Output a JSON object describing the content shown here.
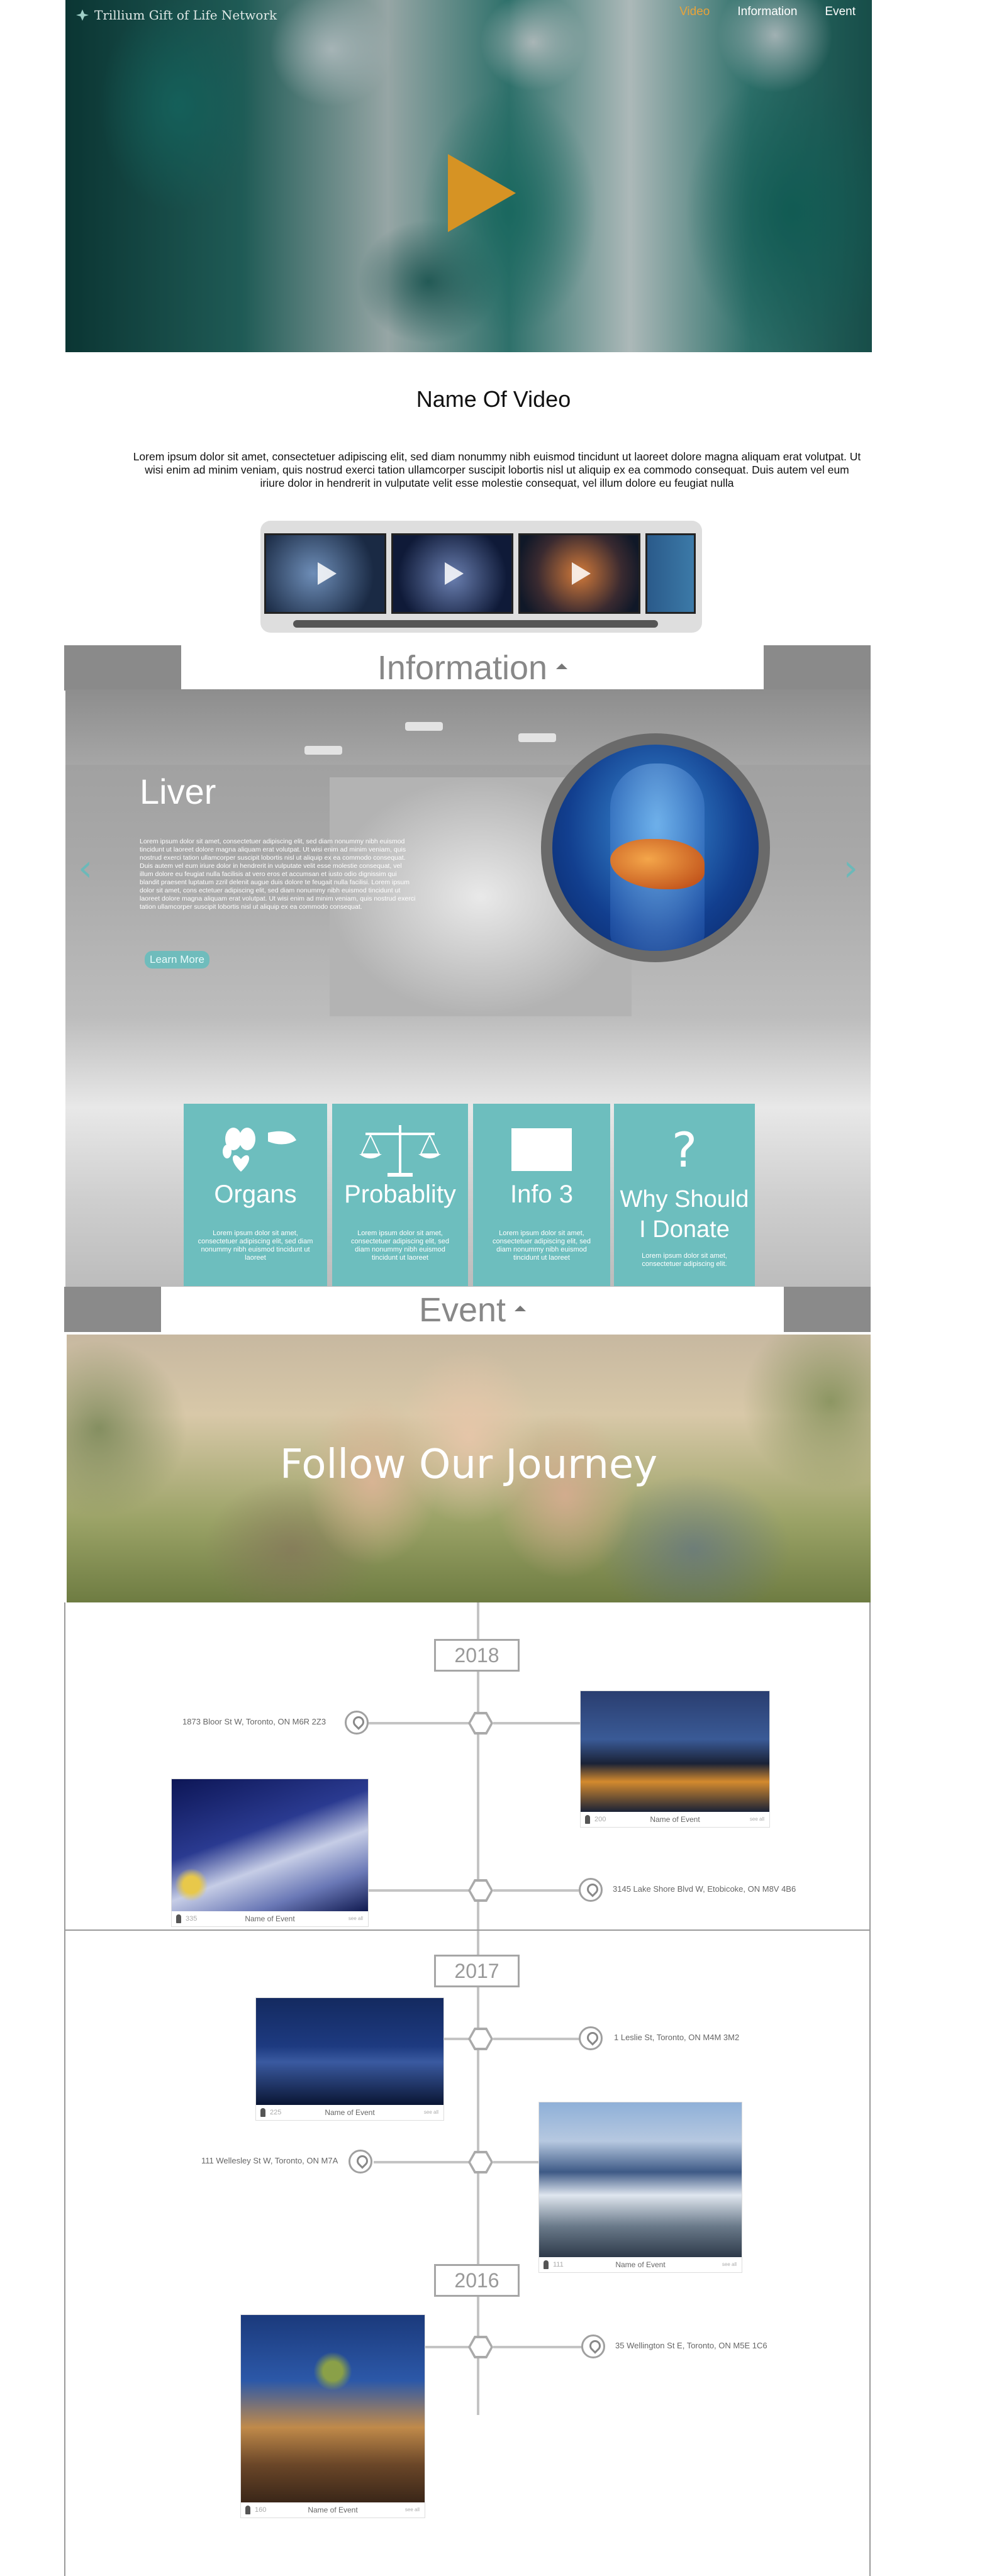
{
  "brand": {
    "name": "Trillium Gift of Life Network"
  },
  "nav": [
    {
      "label": "Video",
      "active": true
    },
    {
      "label": "Information",
      "active": false
    },
    {
      "label": "Event",
      "active": false
    }
  ],
  "video": {
    "title": "Name Of Video",
    "description": "Lorem ipsum dolor sit amet, consectetuer adipiscing elit, sed diam nonummy nibh euismod tincidunt ut laoreet dolore magna aliquam erat volutpat. Ut wisi enim ad minim veniam, quis nostrud exerci tation ullamcorper suscipit lobortis nisl ut aliquip ex ea commodo consequat. Duis autem vel eum iriure dolor in hendrerit in vulputate velit esse molestie consequat, vel illum dolore eu feugiat nulla"
  },
  "information": {
    "heading": "Information",
    "slide": {
      "title": "Liver",
      "text": "Lorem ipsum dolor sit amet, consectetuer adipiscing elit, sed diam nonummy nibh euismod tincidunt ut laoreet dolore magna aliquam erat volutpat. Ut wisi enim ad minim veniam, quis nostrud exerci tation ullamcorper suscipit lobortis nisl ut aliquip ex ea commodo consequat. Duis autem vel eum iriure dolor in hendrerit in vulputate velit esse molestie consequat, vel illum dolore eu feugiat nulla facilisis at vero eros et accumsan et iusto odio dignissim qui blandit praesent luptatum zzril delenit augue duis dolore te feugait nulla facilisi. Lorem ipsum dolor sit amet, cons ectetuer adipiscing elit, sed diam nonummy nibh euismod tincidunt ut laoreet dolore magna aliquam erat volutpat. Ut wisi enim ad minim veniam, quis nostrud exerci tation ullamcorper suscipit lobortis nisl ut aliquip ex ea commodo consequat.",
      "button": "Learn More"
    },
    "cards": [
      {
        "title": "Organs",
        "text": "Lorem ipsum dolor sit amet, consectetuer adipiscing elit, sed diam nonummy nibh euismod tincidunt ut laoreet"
      },
      {
        "title": "Probablity",
        "text": "Lorem ipsum dolor sit amet, consectetuer adipiscing elit, sed diam nonummy nibh euismod tincidunt ut laoreet"
      },
      {
        "title": "Info 3",
        "text": "Lorem ipsum dolor sit amet, consectetuer adipiscing elit, sed diam nonummy nibh euismod tincidunt ut laoreet"
      },
      {
        "title": "Why Should I Donate",
        "text": "Lorem ipsum dolor sit amet, consectetuer adipiscing elit."
      }
    ]
  },
  "event": {
    "heading": "Event",
    "banner": "Follow Our Journey",
    "years": [
      "2018",
      "2017",
      "2016"
    ],
    "items": [
      {
        "address": "1873 Bloor St W, Toronto, ON M6R 2Z3",
        "name": "Name of Event",
        "count": "200",
        "more": "see all"
      },
      {
        "address": "3145 Lake Shore Blvd W, Etobicoke, ON M8V 4B6",
        "name": "Name of Event",
        "count": "335",
        "more": "see all"
      },
      {
        "address": "1 Leslie St, Toronto, ON M4M 3M2",
        "name": "Name of Event",
        "count": "225",
        "more": "see all"
      },
      {
        "address": "111 Wellesley St W, Toronto, ON M7A",
        "name": "Name of Event",
        "count": "111",
        "more": "see all"
      },
      {
        "address": "35 Wellington St E, Toronto, ON M5E 1C6",
        "name": "Name of Event",
        "count": "160",
        "more": "see all"
      }
    ]
  },
  "colors": {
    "accent": "#d69324",
    "teal": "#6dbebe",
    "gray": "#8a8a8a"
  }
}
